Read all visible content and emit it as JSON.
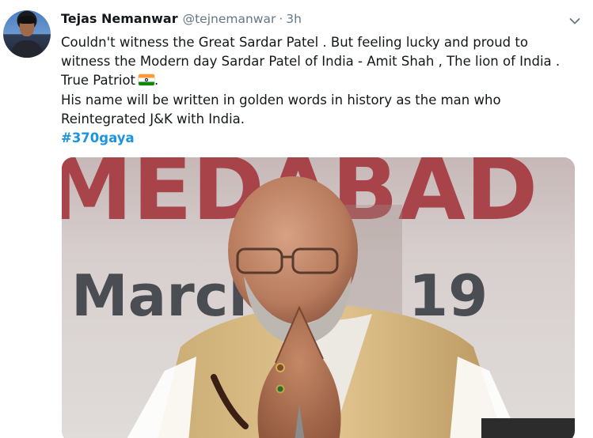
{
  "tweet": {
    "author_name": "Tejas Nemanwar",
    "handle": "@tejnemanwar",
    "separator": "·",
    "time": "3h",
    "lines": [
      "Couldn't witness the Great Sardar Patel . But feeling lucky and proud to",
      "witness the Modern day Sardar Patel of India - Amit Shah , The lion of India .",
      "True Patriot",
      "His name will be written in golden words in history as the man who",
      "Reintegrated J&K with India."
    ],
    "flag_trailing": ".",
    "hashtag": "#370gaya",
    "media": {
      "banner_top_text": "MEDABAD",
      "banner_mid_text": "March",
      "banner_year_text": "19"
    }
  },
  "icons": {
    "caret": "chevron-down-icon",
    "flag": "india-flag-emoji"
  },
  "colors": {
    "link": "#1b95e0",
    "muted": "#657786",
    "text": "#14171a",
    "banner_red": "#a3343a"
  }
}
